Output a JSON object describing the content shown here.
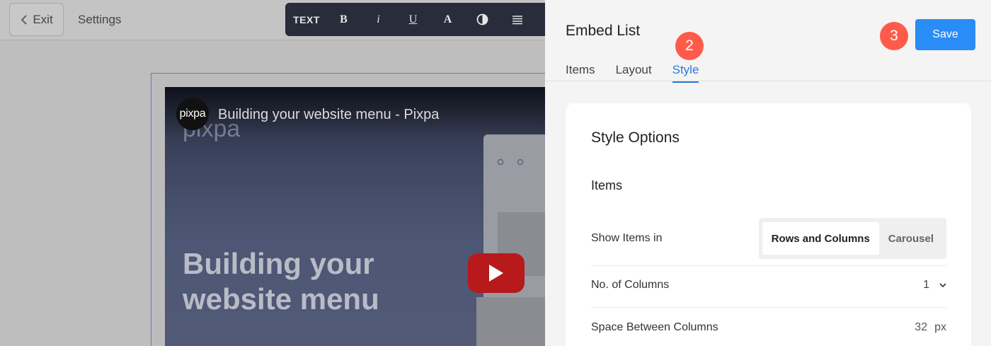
{
  "topbar": {
    "exit_label": "Exit",
    "settings_label": "Settings",
    "format_toolbar": {
      "text_label": "TEXT",
      "bold_label": "B",
      "italic_label": "i",
      "underline_label": "U",
      "font_color_label": "A"
    }
  },
  "video": {
    "channel_name": "pixpa",
    "title": "Building your website menu - Pixpa",
    "background_logo": "pixpa",
    "headline": "Building your website menu",
    "play_color": "#b8191b"
  },
  "panel": {
    "title": "Embed List",
    "tabs": [
      {
        "label": "Items",
        "active": false
      },
      {
        "label": "Layout",
        "active": false
      },
      {
        "label": "Style",
        "active": true
      }
    ],
    "step_badges": [
      "2",
      "3"
    ],
    "save_label": "Save",
    "accent_color": "#2a8cf6",
    "badge_color": "#ff5b4a"
  },
  "style_options": {
    "title": "Style Options",
    "items_section_title": "Items",
    "show_items_in": {
      "label": "Show Items in",
      "options": [
        "Rows and Columns",
        "Carousel"
      ],
      "selected": "Rows and Columns"
    },
    "columns": {
      "label": "No. of Columns",
      "value": "1"
    },
    "space_between_columns": {
      "label": "Space Between Columns",
      "value": "32",
      "unit": "px"
    }
  }
}
